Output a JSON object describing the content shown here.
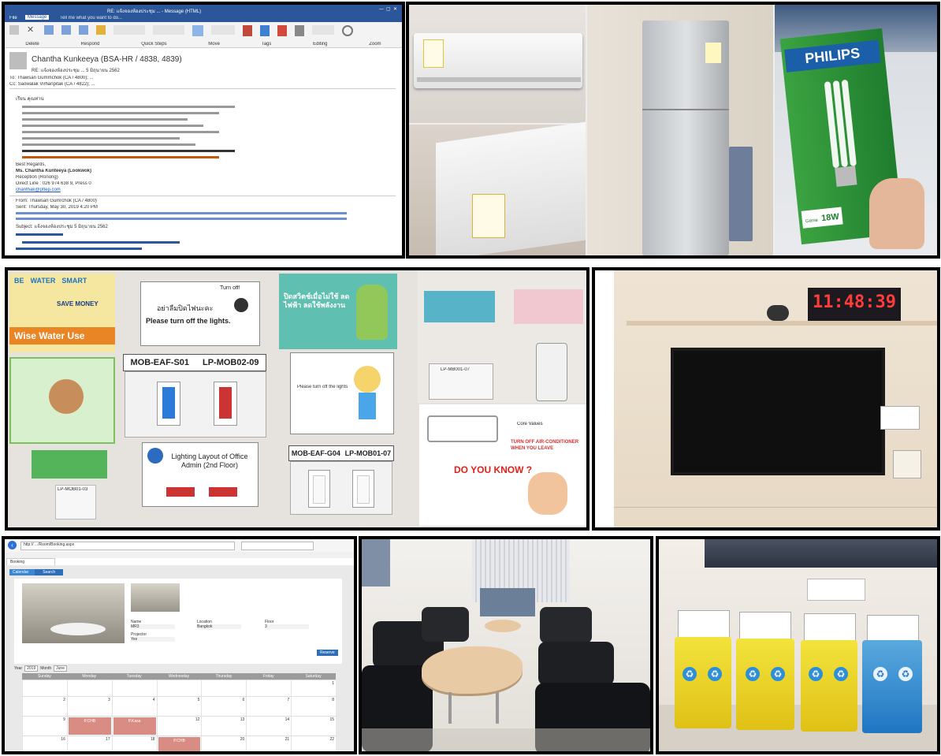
{
  "email": {
    "titlebar": "RE: แจ้งจองห้องประชุม ... - Message (HTML)",
    "ribbon_tabs": [
      "File",
      "Message",
      "Tell me what you want to do..."
    ],
    "ribbon_groups": [
      "Delete",
      "Respond",
      "Quick Steps",
      "Move",
      "Tags",
      "Editing",
      "Zoom"
    ],
    "sender": "Chantha Kunkeeya (BSA-HR / 4838, 4839)",
    "subject": "RE: แจ้งจองห้องประชุม ... 5 มิถุนายน 2562",
    "to": "To: Thawsan Gummchok (CA / 4800); ...",
    "cc": "Cc: Saowalak Virhanpitak (CA / 4822); ...",
    "greeting": "เรียน คุณท่าน",
    "sig_regards": "Best Regards,",
    "sig_name": "Ms. Chantha Kunteeya (Lookwok)",
    "sig_role": "Reception (Ronong)",
    "sig_line": "Direct Line : 026 974 638 9, Press 0",
    "sig_email": "chanthak@pttep.com",
    "from_line": "From: Thawsan Gumrchok (CA / 4800)",
    "sent_line": "Sent: Thursday, May 30, 2019 4:20 PM",
    "subject_line": "Subject: แจ้งจองห้องประชุม 5 มิถุนายน 2562"
  },
  "appliances": {
    "brand_box": "PHILIPS",
    "lamp_label": "Genie",
    "lamp_watt": "18W"
  },
  "signs": {
    "water_left": "BE",
    "water_mid": "WATER",
    "water_right": "SMART",
    "save_money": "SAVE MONEY",
    "wise_water": "Wise Water Use",
    "turn_off_thai": "อย่าลืมปิดไฟนะคะ",
    "turn_off_en": "Please turn off the lights.",
    "turn_off_tag": "Turn off!",
    "switch_label_1": "MOB-EAF-S01",
    "switch_label_2": "LP-MOB02-09",
    "lighting_layout": "Lighting Layout of Office Admin (2nd Floor)",
    "switch_label_3": "MOB-EAF-G04",
    "switch_label_4": "LP-MOB01-07",
    "small_switch_1": "LP-MOB01-03",
    "small_switch_2": "LP-MB001-07",
    "green_poster": "ปิดสวิตช์เมื่อไม่ใช้ ลดไฟฟ้า ลดใช้พลังงาน",
    "girl_sign": "Please turn off the lights",
    "do_you_know": "DO YOU KNOW ?",
    "core_values": "Core Values",
    "aircon_note": "TURN OFF AIR-CONDITIONER WHEN YOU LEAVE"
  },
  "clock": {
    "time": "11:48:39"
  },
  "booking": {
    "breadcrumb": [
      "Calendar",
      "Search"
    ],
    "name_label": "Name",
    "name_value": "MR3",
    "location_label": "Location",
    "location_value": "Bangkok",
    "floor_label": "Floor",
    "floor_value": "3",
    "projector_label": "Projector",
    "projector_value": "Yes",
    "reserve_btn": "Reserve",
    "year_label": "Year",
    "year_value": "2019",
    "month_label": "Month",
    "month_value": "June",
    "weekdays": [
      "Sunday",
      "Monday",
      "Tuesday",
      "Wednesday",
      "Thursday",
      "Friday",
      "Saturday"
    ],
    "week_rows": [
      [
        "",
        "",
        "",
        "",
        "",
        "",
        "1"
      ],
      [
        "2",
        "3",
        "4",
        "5",
        "6",
        "7",
        "8"
      ],
      [
        "9",
        "10",
        "11",
        "12",
        "13",
        "14",
        "15"
      ],
      [
        "16",
        "17",
        "18",
        "19",
        "20",
        "21",
        "22"
      ]
    ],
    "events": [
      "P.CHB",
      "P.Kasa",
      "P.CHB",
      "P.CHB"
    ],
    "browser_url": "http://  .../Room/Booking.aspx",
    "browser_tab": "Booking"
  }
}
